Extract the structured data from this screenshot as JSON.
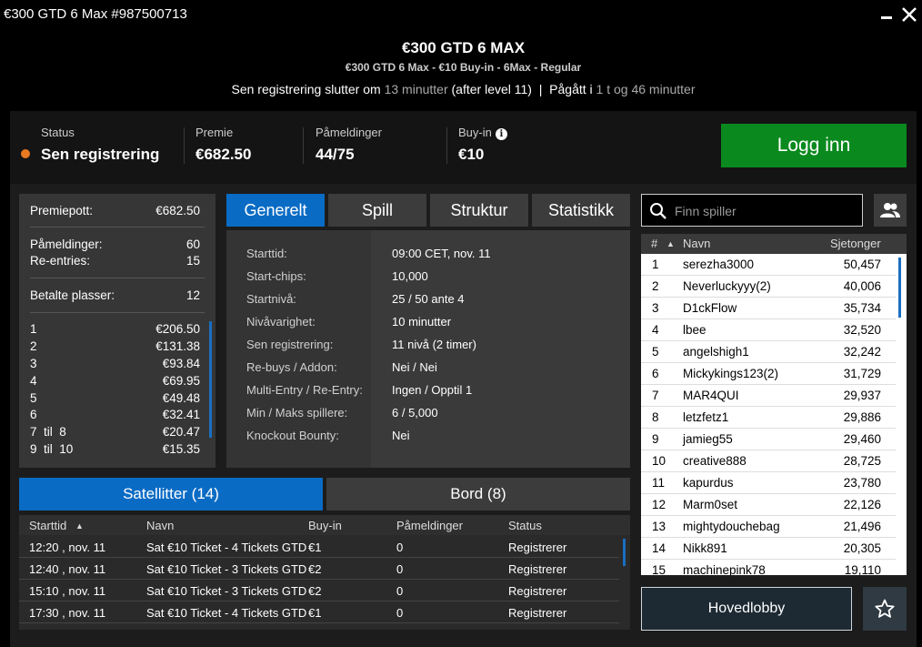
{
  "window": {
    "title": "€300 GTD 6 Max #987500713"
  },
  "header": {
    "title": "€300 GTD 6 MAX",
    "subtitle": "€300 GTD 6 Max - €10 Buy-in - 6Max - Regular",
    "late_reg_prefix": "Sen registrering slutter om",
    "late_reg_time": "13 minutter",
    "late_reg_suffix": "(after level 11)",
    "separator": "|",
    "running_prefix": "Pågått i",
    "running_time": "1 t og 46 minutter"
  },
  "status_bar": {
    "status_label": "Status",
    "status_value": "Sen registrering",
    "status_color": "#e87a22",
    "prize_label": "Premie",
    "prize_value": "€682.50",
    "entries_label": "Påmeldinger",
    "entries_value": "44/75",
    "buyin_label": "Buy-in",
    "buyin_value": "€10",
    "login_button": "Logg inn",
    "login_color": "#0a8a1e"
  },
  "prize_panel": {
    "prize_pool_label": "Premiepott:",
    "prize_pool_value": "€682.50",
    "entries_label": "Påmeldinger:",
    "entries_value": "60",
    "reentries_label": "Re-entries:",
    "reentries_value": "15",
    "paid_label": "Betalte plasser:",
    "paid_value": "12",
    "payouts": [
      {
        "place": "1",
        "amount": "€206.50"
      },
      {
        "place": "2",
        "amount": "€131.38"
      },
      {
        "place": "3",
        "amount": "€93.84"
      },
      {
        "place": "4",
        "amount": "€69.95"
      },
      {
        "place": "5",
        "amount": "€49.48"
      },
      {
        "place": "6",
        "amount": "€32.41"
      },
      {
        "place": "7  til  8",
        "amount": "€20.47"
      },
      {
        "place": "9  til  10",
        "amount": "€15.35"
      }
    ]
  },
  "tabs": [
    {
      "label": "Generelt",
      "active": true
    },
    {
      "label": "Spill",
      "active": false
    },
    {
      "label": "Struktur",
      "active": false
    },
    {
      "label": "Statistikk",
      "active": false
    }
  ],
  "general": [
    {
      "label": "Starttid:",
      "value": "09:00 CET, nov. 11"
    },
    {
      "label": "Start-chips:",
      "value": "10,000"
    },
    {
      "label": "Startnivå:",
      "value": "25 / 50 ante 4"
    },
    {
      "label": "Nivåvarighet:",
      "value": "10 minutter"
    },
    {
      "label": "Sen registrering:",
      "value": "11 nivå (2 timer)"
    },
    {
      "label": "Re-buys / Addon:",
      "value": "Nei / Nei"
    },
    {
      "label": "Multi-Entry / Re-Entry:",
      "value": "Ingen / Opptil 1"
    },
    {
      "label": "Min / Maks spillere:",
      "value": "6 / 5,000"
    },
    {
      "label": "Knockout Bounty:",
      "value": "Nei"
    }
  ],
  "bottom_tabs": [
    {
      "label": "Satellitter (14)",
      "active": true
    },
    {
      "label": "Bord (8)",
      "active": false
    }
  ],
  "satellites": {
    "headers": {
      "start": "Starttid",
      "sort_icon": "▲",
      "name": "Navn",
      "buyin": "Buy-in",
      "entries": "Påmeldinger",
      "status": "Status"
    },
    "rows": [
      {
        "start": "12:20 , nov. 11",
        "name": "Sat €10 Ticket - 4 Tickets GTD",
        "buyin": "€1",
        "entries": "0",
        "status": "Registrerer"
      },
      {
        "start": "12:40 , nov. 11",
        "name": "Sat €10 Ticket - 3 Tickets GTD",
        "buyin": "€2",
        "entries": "0",
        "status": "Registrerer"
      },
      {
        "start": "15:10 , nov. 11",
        "name": "Sat €10 Ticket - 3 Tickets GTD",
        "buyin": "€2",
        "entries": "0",
        "status": "Registrerer"
      },
      {
        "start": "17:30 , nov. 11",
        "name": "Sat €10 Ticket - 4 Tickets GTD",
        "buyin": "€1",
        "entries": "0",
        "status": "Registrerer"
      }
    ]
  },
  "search": {
    "placeholder": "Finn spiller"
  },
  "players": {
    "headers": {
      "rank": "#",
      "sort_icon": "▲",
      "name": "Navn",
      "chips": "Sjetonger"
    },
    "rows": [
      {
        "rank": "1",
        "name": "serezha3000",
        "chips": "50,457"
      },
      {
        "rank": "2",
        "name": "Neverluckyyy(2)",
        "chips": "40,006"
      },
      {
        "rank": "3",
        "name": "D1ckFlow",
        "chips": "35,734"
      },
      {
        "rank": "4",
        "name": "lbee",
        "chips": "32,520"
      },
      {
        "rank": "5",
        "name": "angelshigh1",
        "chips": "32,242"
      },
      {
        "rank": "6",
        "name": "Mickykings123(2)",
        "chips": "31,729"
      },
      {
        "rank": "7",
        "name": "MAR4QUI",
        "chips": "29,937"
      },
      {
        "rank": "8",
        "name": "letzfetz1",
        "chips": "29,886"
      },
      {
        "rank": "9",
        "name": "jamieg55",
        "chips": "29,460"
      },
      {
        "rank": "10",
        "name": "creative888",
        "chips": "28,725"
      },
      {
        "rank": "11",
        "name": "kapurdus",
        "chips": "23,780"
      },
      {
        "rank": "12",
        "name": "Marm0set",
        "chips": "22,126"
      },
      {
        "rank": "13",
        "name": "mightydouchebag",
        "chips": "21,496"
      },
      {
        "rank": "14",
        "name": "Nikk891",
        "chips": "20,305"
      },
      {
        "rank": "15",
        "name": "machinepink78",
        "chips": "19,110"
      }
    ]
  },
  "footer": {
    "lobby_button": "Hovedlobby"
  },
  "icons": {
    "close": "close-icon",
    "minimize": "minimize-icon",
    "info": "info-icon",
    "search": "search-icon",
    "players": "users-icon",
    "favorite": "star-icon"
  }
}
